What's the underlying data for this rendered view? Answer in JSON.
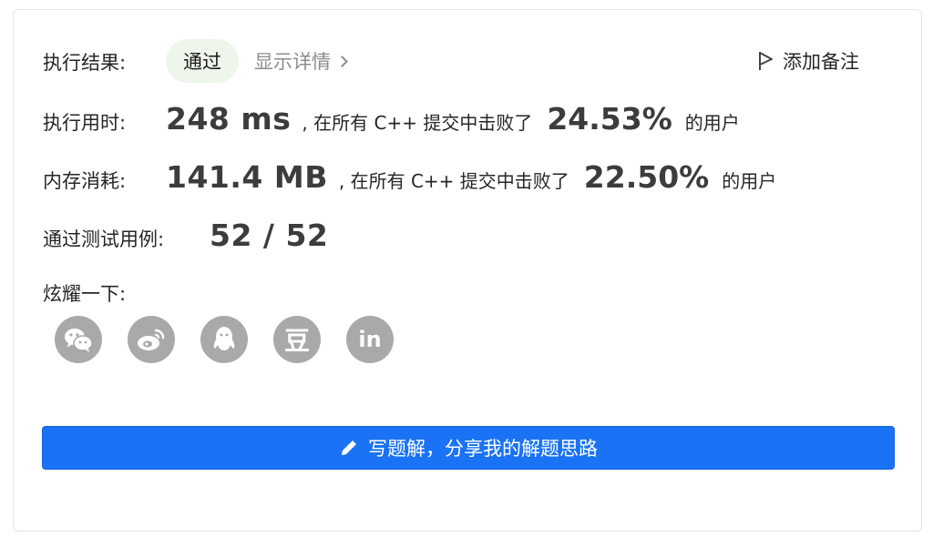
{
  "result": {
    "label": "执行结果:",
    "status": "通过",
    "details_link": "显示详情",
    "add_note": "添加备注"
  },
  "runtime": {
    "label": "执行用时:",
    "value": "248 ms",
    "middle_text": ", 在所有 C++ 提交中击败了",
    "percent": "24.53%",
    "suffix": "的用户"
  },
  "memory": {
    "label": "内存消耗:",
    "value": "141.4 MB",
    "middle_text": ", 在所有 C++ 提交中击败了",
    "percent": "22.50%",
    "suffix": "的用户"
  },
  "testcases": {
    "label": "通过测试用例:",
    "value": "52 / 52"
  },
  "share": {
    "title": "炫耀一下:",
    "icons": [
      "wechat-icon",
      "weibo-icon",
      "qq-icon",
      "douban-icon",
      "linkedin-icon"
    ],
    "douban_glyph": "豆",
    "linkedin_glyph": "in"
  },
  "write_solution": {
    "label": "写题解，分享我的解题思路",
    "icon": "pencil-icon"
  },
  "colors": {
    "accent": "#1a73f5",
    "badge_bg": "#eef6ec",
    "icon_gray": "#a9a9a9"
  }
}
